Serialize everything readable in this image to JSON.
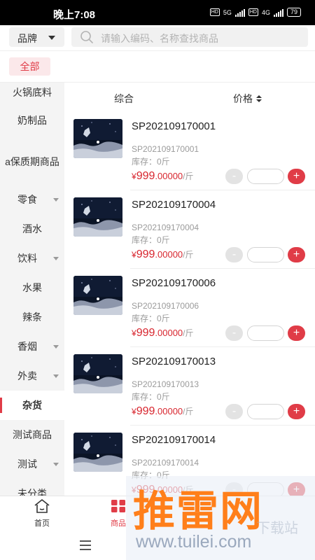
{
  "status_bar": {
    "time": "晚上7:08",
    "network_a": "5G",
    "network_b": "4G",
    "battery": "79"
  },
  "search": {
    "brand_label": "品牌",
    "placeholder": "请输入编码、名称查找商品"
  },
  "filter": {
    "all_label": "全部"
  },
  "sort": {
    "general_label": "综合",
    "price_label": "价格"
  },
  "sidebar": {
    "items": [
      {
        "label": "火锅底料",
        "has_caret": false,
        "active": false
      },
      {
        "label": "奶制品",
        "has_caret": false,
        "active": false
      },
      {
        "label": "a保质期商品",
        "has_caret": false,
        "active": false
      },
      {
        "label": "零食",
        "has_caret": true,
        "active": false
      },
      {
        "label": "酒水",
        "has_caret": false,
        "active": false
      },
      {
        "label": "饮料",
        "has_caret": true,
        "active": false
      },
      {
        "label": "水果",
        "has_caret": false,
        "active": false
      },
      {
        "label": "辣条",
        "has_caret": false,
        "active": false
      },
      {
        "label": "香烟",
        "has_caret": true,
        "active": false
      },
      {
        "label": "外卖",
        "has_caret": true,
        "active": false
      },
      {
        "label": "杂货",
        "has_caret": false,
        "active": true
      },
      {
        "label": "测试商品",
        "has_caret": false,
        "active": false
      },
      {
        "label": "测试",
        "has_caret": true,
        "active": false
      },
      {
        "label": "未分类",
        "has_caret": false,
        "active": false
      }
    ]
  },
  "products": [
    {
      "title": "SP202109170001",
      "code": "SP202109170001",
      "stock": "库存：0斤",
      "currency": "¥",
      "price_int": "999",
      "price_dec": ".00000",
      "unit": "/斤",
      "minus": "-",
      "plus": "+"
    },
    {
      "title": "SP202109170004",
      "code": "SP202109170004",
      "stock": "库存：0斤",
      "currency": "¥",
      "price_int": "999",
      "price_dec": ".00000",
      "unit": "/斤",
      "minus": "-",
      "plus": "+"
    },
    {
      "title": "SP202109170006",
      "code": "SP202109170006",
      "stock": "库存：0斤",
      "currency": "¥",
      "price_int": "999",
      "price_dec": ".00000",
      "unit": "/斤",
      "minus": "-",
      "plus": "+"
    },
    {
      "title": "SP202109170013",
      "code": "SP202109170013",
      "stock": "库存：0斤",
      "currency": "¥",
      "price_int": "999",
      "price_dec": ".00000",
      "unit": "/斤",
      "minus": "-",
      "plus": "+"
    },
    {
      "title": "SP202109170014",
      "code": "SP202109170014",
      "stock": "库存：0斤",
      "currency": "¥",
      "price_int": "999",
      "price_dec": ".00000",
      "unit": "/斤",
      "minus": "-",
      "plus": "+"
    }
  ],
  "tabbar": {
    "home_label": "首页",
    "goods_label": "商品",
    "goods_color": "#e03c47"
  },
  "watermark": {
    "text": "推雷网",
    "url": "www.tuilei.com",
    "faint": "下载站"
  },
  "colors": {
    "accent": "#e03c47",
    "price": "#d8262f"
  },
  "icons": {
    "search": "search-icon",
    "home": "home-icon",
    "goods": "grid-icon",
    "menu": "menu-icon",
    "sort": "sort-icon"
  }
}
